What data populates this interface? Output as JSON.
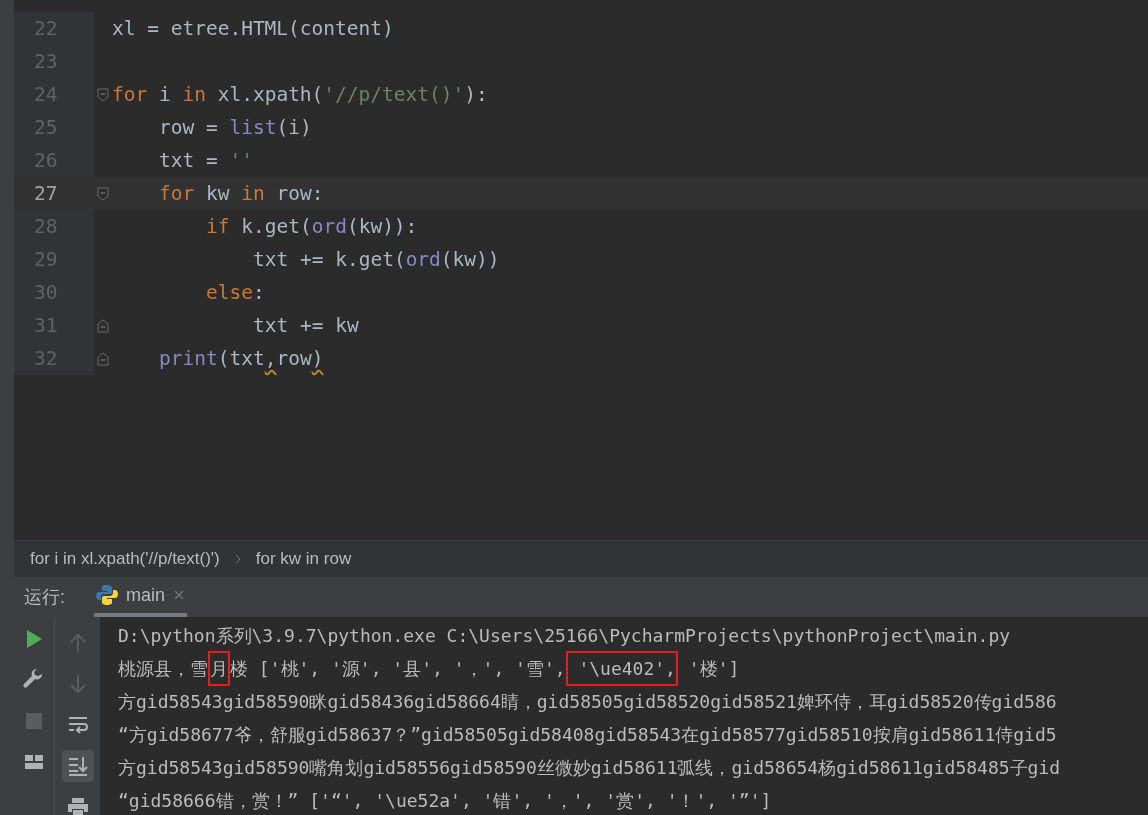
{
  "editor": {
    "lines": [
      {
        "num": "22",
        "current": false,
        "tokens": [
          {
            "t": "xl = etree.HTML(content)",
            "kind": "plain"
          }
        ]
      },
      {
        "num": "23",
        "current": false
      },
      {
        "num": "24",
        "kind": "fold_start",
        "current": false,
        "tokens": [
          {
            "t": "for",
            "kind": "keyword"
          },
          {
            "t": " i ",
            "kind": "plain"
          },
          {
            "t": "in",
            "kind": "keyword"
          },
          {
            "t": " xl.xpath(",
            "kind": "plain"
          },
          {
            "t": "'//p/text()'",
            "kind": "string"
          },
          {
            "t": "):",
            "kind": "plain"
          }
        ],
        "children": [
          {
            "num": "25",
            "current": false,
            "tokens": [
              {
                "t": "row = ",
                "kind": "plain"
              },
              {
                "t": "list",
                "kind": "builtin"
              },
              {
                "t": "(i)",
                "kind": "plain"
              }
            ]
          },
          {
            "num": "26",
            "current": false,
            "tokens": [
              {
                "t": "txt = ",
                "kind": "plain"
              },
              {
                "t": "''",
                "kind": "string"
              }
            ]
          },
          {
            "num": "27",
            "kind": "fold_start",
            "current": true,
            "tokens": [
              {
                "t": "for",
                "kind": "keyword"
              },
              {
                "t": " kw ",
                "kind": "plain"
              },
              {
                "t": "in",
                "kind": "keyword"
              },
              {
                "t": " row:",
                "kind": "plain"
              }
            ],
            "children": [
              {
                "num": "28",
                "current": false,
                "tokens": [
                  {
                    "t": "if",
                    "kind": "keyword"
                  },
                  {
                    "t": " k.get(",
                    "kind": "plain"
                  },
                  {
                    "t": "ord",
                    "kind": "builtin"
                  },
                  {
                    "t": "(kw)):",
                    "kind": "plain"
                  }
                ],
                "children": [
                  {
                    "num": "29",
                    "current": false,
                    "tokens": [
                      {
                        "t": "txt += k.get(",
                        "kind": "plain"
                      },
                      {
                        "t": "ord",
                        "kind": "builtin"
                      },
                      {
                        "t": "(kw))",
                        "kind": "plain"
                      }
                    ]
                  }
                ]
              },
              {
                "num": "30",
                "current": false,
                "tokens": [
                  {
                    "t": "else",
                    "kind": "keyword"
                  },
                  {
                    "t": ":",
                    "kind": "plain"
                  }
                ],
                "children": [
                  {
                    "num": "31",
                    "kind": "fold_end",
                    "current": false,
                    "tokens": [
                      {
                        "t": "txt += kw",
                        "kind": "plain"
                      }
                    ]
                  }
                ]
              }
            ]
          },
          {
            "num": "32",
            "kind": "fold_end",
            "current": false,
            "tokens": [
              {
                "t": "print",
                "kind": "builtin"
              },
              {
                "t": "(txt",
                "kind": "plain"
              },
              {
                "t": ",",
                "kind": "plain",
                "warn": true
              },
              {
                "t": "row",
                "kind": "plain"
              },
              {
                "t": ")",
                "kind": "plain",
                "warn": true
              }
            ]
          }
        ]
      }
    ]
  },
  "breadcrumbs": [
    "for i in xl.xpath('//p/text()')",
    "for kw in row"
  ],
  "run_panel": {
    "label": "运行:",
    "tabs": [
      {
        "label": "main",
        "selected": true
      }
    ],
    "left_tools": [
      {
        "kind": "run",
        "disabled": false
      },
      {
        "kind": "wrench",
        "disabled": false
      },
      {
        "kind": "stop",
        "disabled": true
      },
      {
        "kind": "layout",
        "disabled": false
      }
    ],
    "right_tools": [
      {
        "kind": "up",
        "disabled": true,
        "selected": false
      },
      {
        "kind": "down",
        "disabled": true,
        "selected": false
      },
      {
        "kind": "wrap",
        "disabled": false,
        "selected": false
      },
      {
        "kind": "scroll-end",
        "disabled": false,
        "selected": true
      },
      {
        "kind": "print",
        "disabled": false,
        "selected": false
      }
    ],
    "console": [
      [
        {
          "t": "D:\\python系列\\3.9.7\\python.exe C:\\Users\\25166\\PycharmProjects\\pythonProject\\main.py",
          "boxed": false
        }
      ],
      [
        {
          "t": "桃源县，雪",
          "boxed": false
        },
        {
          "t": "月",
          "boxed": true
        },
        {
          "t": "楼 ['桃', '源', '县', '，', '雪',",
          "boxed": false
        },
        {
          "t": " '\\ue402',",
          "boxed": true
        },
        {
          "t": " '楼']",
          "boxed": false
        }
      ],
      [
        {
          "t": "方gid58543gid58590眯gid58436gid58664睛，gid58505gid58520gid58521婢环侍，耳gid58520传gid586",
          "boxed": false
        }
      ],
      [
        {
          "t": "“方gid58677爷，舒服gid58637？”gid58505gid58408gid58543在gid58577gid58510按肩gid58611侍gid5",
          "boxed": false
        }
      ],
      [
        {
          "t": "方gid58543gid58590嘴角划gid58556gid58590丝微妙gid58611弧线，gid58654杨gid58611gid58485子gid",
          "boxed": false
        }
      ],
      [
        {
          "t": "“gid58666错，赏！” ['“', '\\ue52a', '错', '，', '赏', '！', '”']",
          "boxed": false
        }
      ]
    ]
  }
}
